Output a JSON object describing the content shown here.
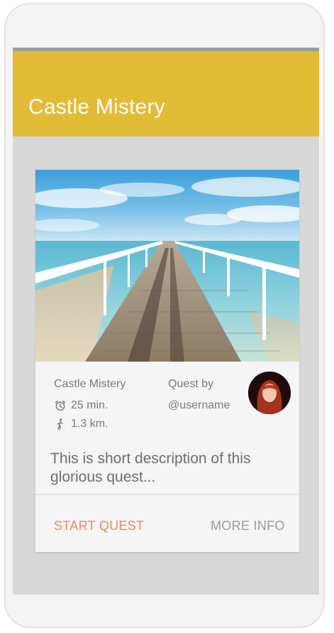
{
  "app": {
    "title": "Castle Mistery"
  },
  "card": {
    "quest_name": "Castle Mistery",
    "duration": "25 min.",
    "distance": "1.3 km.",
    "quest_by_label": "Quest by",
    "username": "@username",
    "description": "This is short description of this glorious quest...",
    "image_subject": "sea-pier-photo",
    "icons": {
      "duration": "alarm-clock-icon",
      "distance": "walking-person-icon"
    }
  },
  "actions": {
    "start_label": "START QUEST",
    "more_label": "MORE INFO"
  },
  "colors": {
    "appbar": "#e2bb37",
    "start_action": "#f0855d",
    "more_action": "#9a9a9a",
    "screen_background": "#d8d8d8",
    "card_background": "#f5f5f5"
  }
}
